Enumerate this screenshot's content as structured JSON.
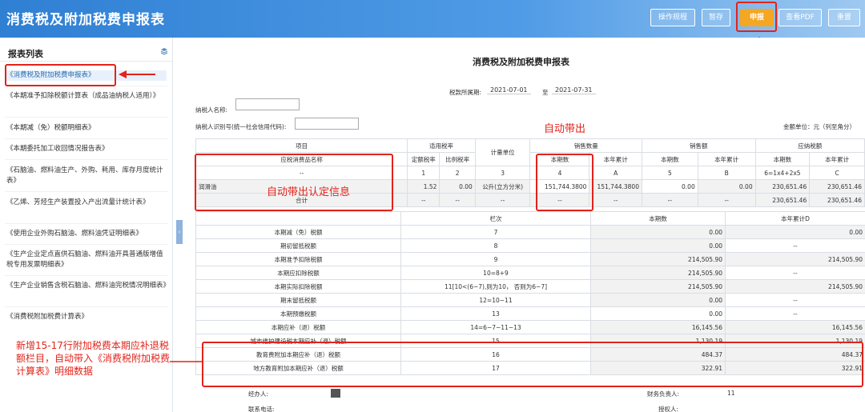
{
  "header": {
    "title": "消费税及附加税费申报表",
    "buttons": [
      "操作规程",
      "暂存",
      "申报",
      "查看PDF",
      "重置"
    ]
  },
  "sidebar": {
    "title": "报表列表",
    "items": [
      "《消费税及附加税费申报表》",
      "《本期准予扣除税额计算表（成品油纳税人适用）》",
      "《本期减（免）税额明细表》",
      "《本期委托加工收回情况报告表》",
      "《石脑油、燃料油生产、外购、耗用、库存月度统计表》",
      "《乙烯、芳烃生产装置投入产出流量计统计表》",
      "《使用企业外购石脑油、燃料油凭证明细表》",
      "《生产企业定点直供石脑油、燃料油开具普通版增值税专用发票明细表》",
      "《生产企业销售含税石脑油、燃料油完税情况明细表》",
      "《消费税附加税费计算表》"
    ]
  },
  "form": {
    "title": "消费税及附加税费申报表",
    "period_label": "税款所属期:",
    "period_start": "2021-07-01",
    "period_to": "至",
    "period_end": "2021-07-31",
    "taxpayer_name_label": "纳税人名称:",
    "taxpayer_id_label": "纳税人识别号(统一社会信用代码):",
    "unit_label": "金额单位：元（列至角分）"
  },
  "table1": {
    "h_item": "项目",
    "h_rate": "适用税率",
    "h_unit": "计量单位",
    "h_qty": "销售数量",
    "h_sales": "销售额",
    "h_tax": "应纳税额",
    "h_name": "应税消费品名称",
    "h_fixed": "定额税率",
    "h_ratio": "比例税率",
    "h_cur": "本期数",
    "h_ytd": "本年累计",
    "r3": [
      "--",
      "1",
      "2",
      "3",
      "4",
      "A",
      "5",
      "B",
      "6=1x4+2x5",
      "C"
    ],
    "row": [
      "润滑油",
      "1.52",
      "0.00",
      "公升(立方分米)",
      "151,744.3800",
      "151,744.3800",
      "0.00",
      "0.00",
      "230,651.46",
      "230,651.46"
    ],
    "total": [
      "合计",
      "--",
      "--",
      "--",
      "--",
      "--",
      "--",
      "--",
      "230,651.46",
      "230,651.46"
    ]
  },
  "table2": {
    "h_col": "栏次",
    "h_cur": "本期数",
    "h_ytd": "本年累计D",
    "rows": [
      [
        "本期减（免）税额",
        "7",
        "0.00",
        "0.00"
      ],
      [
        "期初留抵税额",
        "8",
        "0.00",
        "--"
      ],
      [
        "本期准予扣除税额",
        "9",
        "214,505.90",
        "214,505.90"
      ],
      [
        "本期应扣除税额",
        "10=8+9",
        "214,505.90",
        "--"
      ],
      [
        "本期实际扣除税额",
        "11[10<(6−7),则为10， 否则为6−7]",
        "214,505.90",
        "214,505.90"
      ],
      [
        "期末留抵税额",
        "12=10−11",
        "0.00",
        "--"
      ],
      [
        "本期预缴税额",
        "13",
        "0.00",
        "--"
      ],
      [
        "本期应补（退）税额",
        "14=6−7−11−13",
        "16,145.56",
        "16,145.56"
      ],
      [
        "城市维护建设税本期应补（退）税额",
        "15",
        "1,130.19",
        "1,130.19"
      ],
      [
        "教育费附加本期应补（退）税额",
        "16",
        "484.37",
        "484.37"
      ],
      [
        "地方教育附加本期应补（退）税额",
        "17",
        "322.91",
        "322.91"
      ]
    ]
  },
  "footer": {
    "agent_label": "经办人:",
    "phone_label": "联系电话:",
    "finance_label": "财务负责人:",
    "finance_value": "11",
    "auth_label": "授权人:"
  },
  "annotations": {
    "auto_out": "自动带出",
    "auto_info": "自动带出认定信息",
    "note": "新增15-17行附加税费本期应补退税额栏目，自动带入《消费税附加税费计算表》明细数据"
  },
  "colors": {
    "header": "#2f7fd3",
    "accent": "#f5a623",
    "annotation": "#e2231a"
  }
}
